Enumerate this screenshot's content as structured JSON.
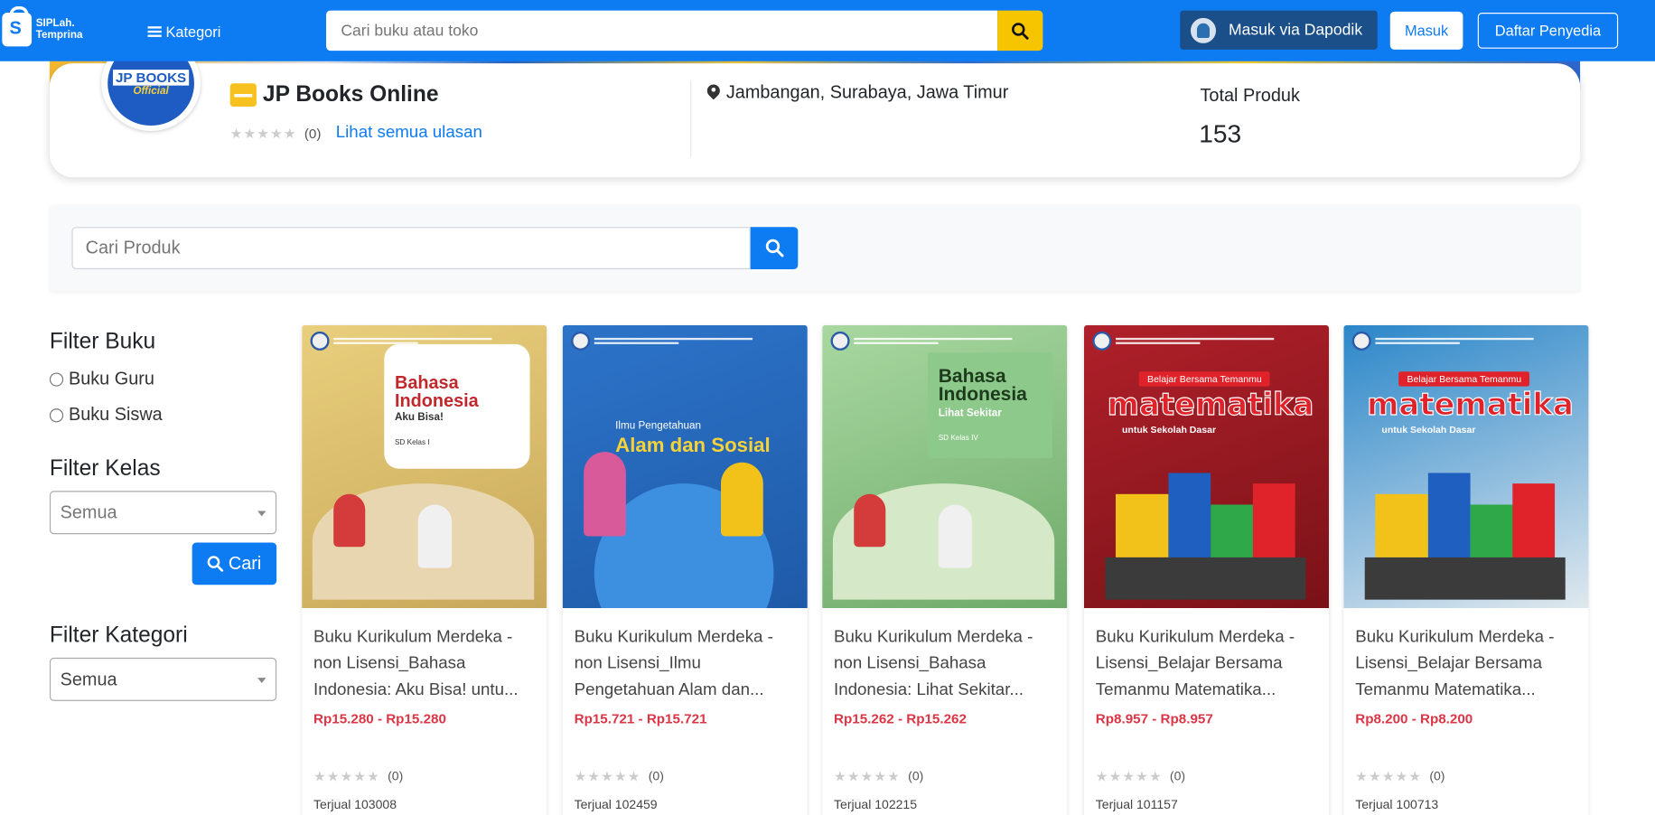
{
  "nav": {
    "logo_line1": "SIPLah.",
    "logo_line2": "Temprina",
    "kategori_label": "Kategori",
    "search_placeholder": "Cari buku atau toko",
    "dapodik_label": "Masuk via Dapodik",
    "masuk_label": "Masuk",
    "daftar_label": "Daftar Penyedia",
    "accent_color": "#0d7bf2",
    "search_button_color": "#f7c500"
  },
  "store": {
    "avatar_line1": "JP BOOKS",
    "avatar_line2": "Official",
    "name": "JP Books Online",
    "rating_count": "(0)",
    "reviews_link": "Lihat semua ulasan",
    "location": "Jambangan, Surabaya, Jawa Timur",
    "total_label": "Total Produk",
    "total_value": "153"
  },
  "product_search": {
    "placeholder": "Cari Produk"
  },
  "filters": {
    "buku_title": "Filter Buku",
    "buku_options": [
      "Buku Guru",
      "Buku Siswa"
    ],
    "kelas_title": "Filter Kelas",
    "kelas_selected": "Semua",
    "cari_label": "Cari",
    "kategori_title": "Filter Kategori",
    "kategori_selected": "Semua"
  },
  "products": [
    {
      "title": "Buku Kurikulum Merdeka - non Lisensi_Bahasa Indonesia: Aku Bisa! untu...",
      "price": "Rp15.280 - Rp15.280",
      "rating_count": "(0)",
      "sold": "Terjual 103008",
      "cover_title": "Bahasa Indonesia",
      "cover_subtitle": "Aku Bisa!",
      "cover_grade": "SD Kelas I",
      "cover_colors": [
        "#e9cf7d",
        "#c8a85a"
      ]
    },
    {
      "title": "Buku Kurikulum Merdeka - non Lisensi_Ilmu Pengetahuan Alam dan...",
      "price": "Rp15.721 - Rp15.721",
      "rating_count": "(0)",
      "sold": "Terjual 102459",
      "cover_title": "Alam dan Sosial",
      "cover_subtitle": "Ilmu Pengetahuan",
      "cover_grade": "",
      "cover_colors": [
        "#2c74c9",
        "#1f5aa8"
      ]
    },
    {
      "title": "Buku Kurikulum Merdeka - non Lisensi_Bahasa Indonesia: Lihat Sekitar...",
      "price": "Rp15.262 - Rp15.262",
      "rating_count": "(0)",
      "sold": "Terjual 102215",
      "cover_title": "Bahasa Indonesia",
      "cover_subtitle": "Lihat Sekitar",
      "cover_grade": "SD Kelas IV",
      "cover_colors": [
        "#a8d8a0",
        "#6faa6a"
      ]
    },
    {
      "title": "Buku Kurikulum Merdeka - Lisensi_Belajar Bersama Temanmu Matematika...",
      "price": "Rp8.957 - Rp8.957",
      "rating_count": "(0)",
      "sold": "Terjual 101157",
      "cover_title": "matematika",
      "cover_subtitle": "untuk Sekolah Dasar",
      "cover_grade": "Belajar Bersama Temanmu",
      "cover_colors": [
        "#b0202a",
        "#7a1218"
      ]
    },
    {
      "title": "Buku Kurikulum Merdeka - Lisensi_Belajar Bersama Temanmu Matematika...",
      "price": "Rp8.200 - Rp8.200",
      "rating_count": "(0)",
      "sold": "Terjual 100713",
      "cover_title": "matematika",
      "cover_subtitle": "untuk Sekolah Dasar",
      "cover_grade": "Belajar Bersama Temanmu",
      "cover_colors": [
        "#2a86c9",
        "#dfe8ee"
      ]
    }
  ]
}
